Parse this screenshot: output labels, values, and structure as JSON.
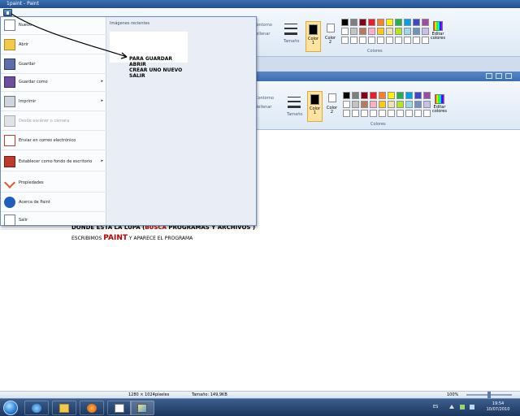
{
  "window": {
    "title": "1paint - Paint"
  },
  "ribbon": {
    "outline_label": "Contorno",
    "fill_label": "Rellenar",
    "size_label": "Tamaño",
    "color1_label": "Color\n1",
    "color2_label": "Color\n2",
    "edit_colors_label": "Editar\ncolores",
    "colors_group_label": "Colores"
  },
  "palette_colors": [
    "#000000",
    "#7f7f7f",
    "#880015",
    "#ed1c24",
    "#ff7f27",
    "#fff200",
    "#22b14c",
    "#00a2e8",
    "#3f48cc",
    "#a349a4",
    "#ffffff",
    "#c3c3c3",
    "#b97a57",
    "#ffaec9",
    "#ffc90e",
    "#efe4b0",
    "#b5e61d",
    "#99d9ea",
    "#7092be",
    "#c8bfe7",
    "#ffffff",
    "#ffffff",
    "#ffffff",
    "#ffffff",
    "#ffffff",
    "#ffffff",
    "#ffffff",
    "#ffffff",
    "#ffffff",
    "#ffffff"
  ],
  "app_menu": {
    "items": [
      {
        "label": "Nuevo",
        "icon": "new-file-icon",
        "disabled": false,
        "submenu": false
      },
      {
        "label": "Abrir",
        "icon": "open-folder-icon",
        "disabled": false,
        "submenu": false
      },
      {
        "label": "Guardar",
        "icon": "save-icon",
        "disabled": false,
        "submenu": false
      },
      {
        "label": "Guardar como",
        "icon": "save-as-icon",
        "disabled": false,
        "submenu": true
      },
      {
        "label": "Imprimir",
        "icon": "printer-icon",
        "disabled": false,
        "submenu": true
      },
      {
        "label": "Desde escáner o cámara",
        "icon": "scanner-icon",
        "disabled": true,
        "submenu": false
      },
      {
        "label": "Enviar en correo electrónico",
        "icon": "email-icon",
        "disabled": false,
        "submenu": false
      },
      {
        "label": "Establecer como fondo de escritorio",
        "icon": "desktop-background-icon",
        "disabled": false,
        "submenu": true
      },
      {
        "label": "Propiedades",
        "icon": "properties-check-icon",
        "disabled": false,
        "submenu": false
      },
      {
        "label": "Acerca de Paint",
        "icon": "info-icon",
        "disabled": false,
        "submenu": false
      },
      {
        "label": "Salir",
        "icon": "exit-icon",
        "disabled": false,
        "submenu": false
      }
    ],
    "recent_heading": "Imágenes recientes",
    "recent_note": "PARA GUARDAR\nABRIR\nCREAR UNO NUEVO\nSALIR"
  },
  "document": {
    "line1_a": "DONDE ESTA LA LUPA (",
    "line1_b": "BUSCA",
    "line1_c": " PROGRAMAS Y ARCHIVOS )",
    "line2_a": "ESCRIBIMOS ",
    "line2_b": "PAINT",
    "line2_c": " Y APARECE EL PROGRAMA"
  },
  "status": {
    "dimensions": "1280 × 1024píxeles",
    "size": "Tamaño: 149,9KB",
    "zoom": "100%",
    "zoom_fraction": 0.5
  },
  "taskbar": {
    "language": "ES",
    "time": "19:54",
    "date": "10/07/2010"
  },
  "colors": {
    "accent_blue": "#2d60a6",
    "menu_background": "#e9eef6",
    "highlight_red": "#c00000"
  }
}
